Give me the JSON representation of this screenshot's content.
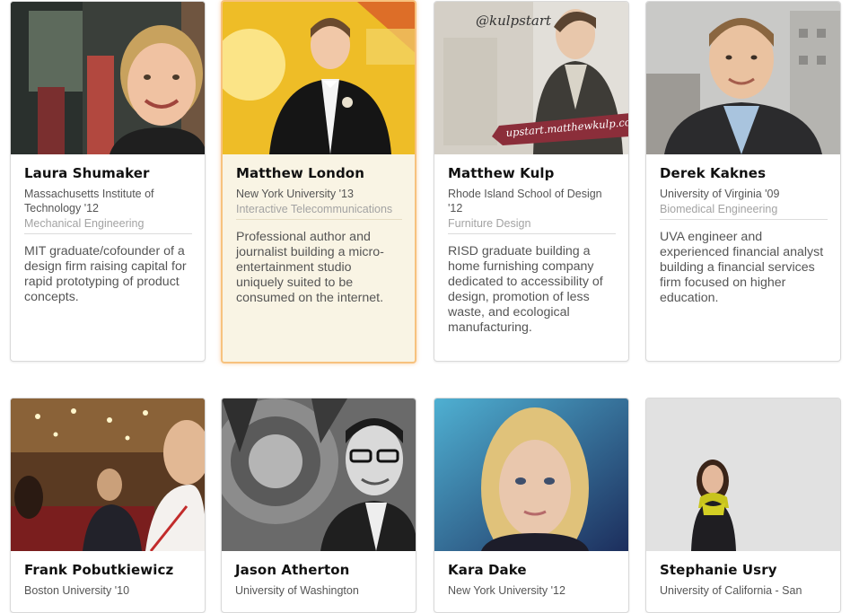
{
  "cards": [
    {
      "name": "Laura Shumaker",
      "school": "Massachusetts Institute of Technology '12",
      "major": "Mechanical Engineering",
      "description": "MIT graduate/cofounder of a design firm raising capital for rapid prototyping of product concepts."
    },
    {
      "name": "Matthew London",
      "school": "New York University '13",
      "major": "Interactive Telecommunications",
      "description": "Professional author and journalist building a micro-entertainment studio uniquely suited to be consumed on the internet."
    },
    {
      "name": "Matthew Kulp",
      "school": "Rhode Island School of Design '12",
      "major": "Furniture Design",
      "description": "RISD graduate building a home furnishing company dedicated to accessibility of design, promotion of less waste, and ecological manufacturing.",
      "photo_text": "@kulpstart",
      "banner_text": "upstart.matthewkulp.com"
    },
    {
      "name": "Derek Kaknes",
      "school": "University of Virginia '09",
      "major": "Biomedical Engineering",
      "description": "UVA engineer and experienced financial analyst building a financial services firm focused on higher education."
    },
    {
      "name": "Frank Pobutkiewicz",
      "school": "Boston University '10",
      "major": "",
      "description": ""
    },
    {
      "name": "Jason Atherton",
      "school": "University of Washington",
      "major": "",
      "description": ""
    },
    {
      "name": "Kara Dake",
      "school": "New York University '12",
      "major": "",
      "description": ""
    },
    {
      "name": "Stephanie Usry",
      "school": "University of California - San",
      "major": "",
      "description": ""
    }
  ],
  "colors": {
    "name": "#111111",
    "school": "#555555",
    "major": "#a3a3a3",
    "highlight_bg": "#f9f4e4",
    "highlight_border": "#f7c27e",
    "banner": "#8b2e3a"
  }
}
